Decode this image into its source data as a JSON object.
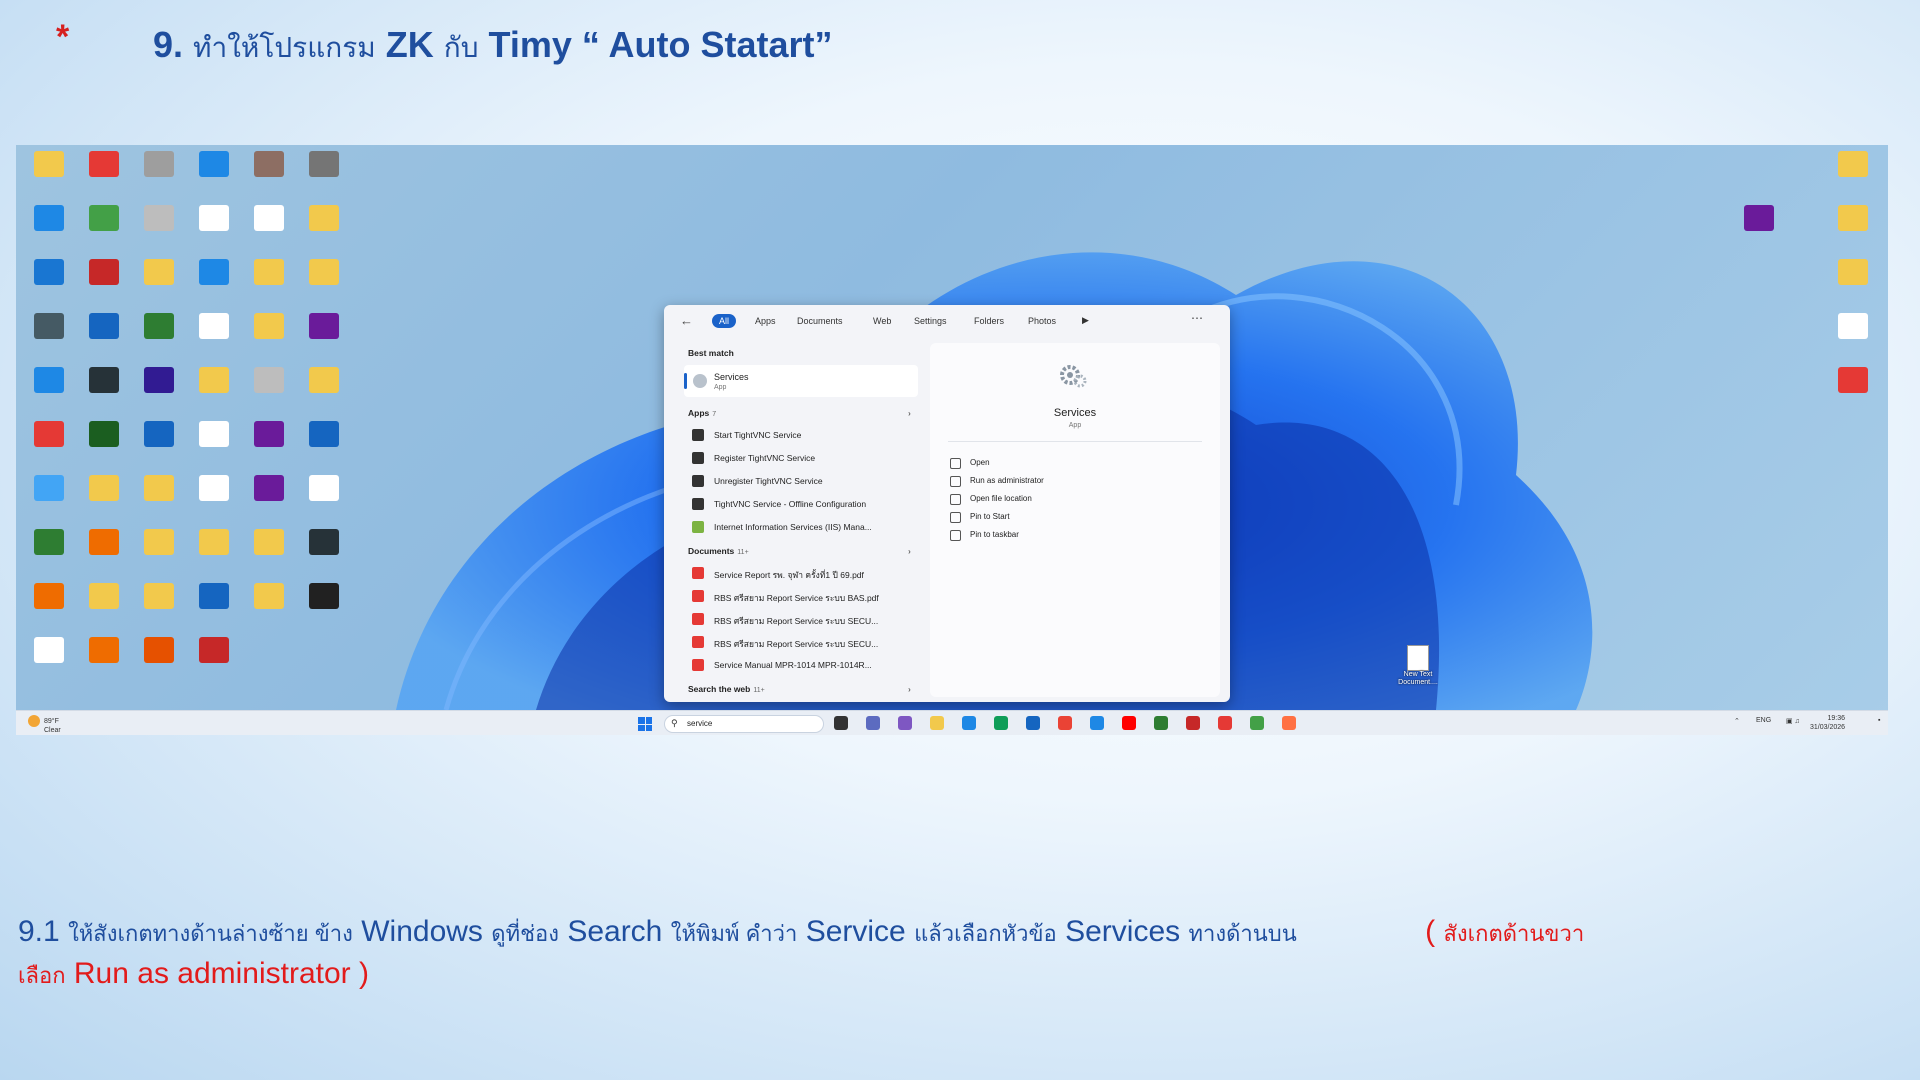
{
  "slide": {
    "asterisk": "*",
    "title_num": "9.",
    "title_th1": "ทำให้โปรแกรม",
    "title_zk": "ZK",
    "title_th2": "กับ",
    "title_timy": "Timy “ Auto Statart”"
  },
  "instruction": {
    "p1_num": "9.1",
    "p1_th1": "ให้สังเกตทางด้านล่างซ้าย ข้าง",
    "p1_windows": "Windows",
    "p1_th2": "ดูที่ช่อง",
    "p1_search": "Search",
    "p1_th3": "ให้พิมพ์ คำว่า",
    "p1_service": "Service",
    "p1_th4": "แล้วเลือกหัวข้อ",
    "p1_services": "Services",
    "p1_th5": "ทางด้านบน",
    "red_open": "(",
    "red_th1": "สังเกตด้านขวา",
    "red_th2": "เลือก",
    "red_run": "Run as administrator )"
  },
  "search_menu": {
    "back_icon": "arrow-left",
    "filters": [
      "All",
      "Apps",
      "Documents",
      "Web",
      "Settings",
      "Folders",
      "Photos"
    ],
    "active_filter": "All",
    "best_match_heading": "Best match",
    "best_match": {
      "name": "Services",
      "type": "App"
    },
    "apps_heading": "Apps",
    "apps_count": "7",
    "apps": [
      "Start TightVNC Service",
      "Register TightVNC Service",
      "Unregister TightVNC Service",
      "TightVNC Service - Offline Configuration",
      "Internet Information Services (IIS) Mana..."
    ],
    "documents_heading": "Documents",
    "documents_count": "11+",
    "documents": [
      "Service Report รพ. จุฬา ครั้งที่1 ปี 69.pdf",
      "RBS ศรีสยาม Report Service ระบบ BAS.pdf",
      "RBS ศรีสยาม Report Service ระบบ SECU...",
      "RBS ศรีสยาม Report Service ระบบ SECU...",
      "Service Manual MPR-1014 MPR-1014R..."
    ],
    "web_heading": "Search the web",
    "web_count": "11+",
    "preview": {
      "title": "Services",
      "subtitle": "App",
      "actions": [
        "Open",
        "Run as administrator",
        "Open file location",
        "Pin to Start",
        "Pin to taskbar"
      ]
    }
  },
  "taskbar": {
    "weather_temp": "89°F",
    "weather_cond": "Clear",
    "search_text": "service",
    "tray_lang": "ENG",
    "time": "19:36",
    "date": "31/03/2026"
  },
  "desktop": {
    "new_text_doc": "New Text Document....",
    "icon_colors": [
      "#f2c94c",
      "#e53935",
      "#9e9e9e",
      "#1e88e5",
      "#8d6e63",
      "#757575",
      "#1e88e5",
      "#43a047",
      "#bdbdbd",
      "#ffffff",
      "#ffffff",
      "#f2c94c",
      "#1976d2",
      "#c62828",
      "#f2c94c",
      "#1e88e5",
      "#f2c94c",
      "#f2c94c",
      "#455a64",
      "#1565c0",
      "#2e7d32",
      "#ffffff",
      "#f2c94c",
      "#6a1b9a",
      "#1e88e5",
      "#263238",
      "#311b92",
      "#f2c94c",
      "#bdbdbd",
      "#f2c94c",
      "#e53935",
      "#1b5e20",
      "#1565c0",
      "#ffffff",
      "#6a1b9a",
      "#1565c0",
      "#42a5f5",
      "#f2c94c",
      "#f2c94c",
      "#ffffff",
      "#6a1b9a",
      "#ffffff",
      "#2e7d32",
      "#ef6c00",
      "#f2c94c",
      "#f2c94c",
      "#f2c94c",
      "#263238",
      "#ef6c00",
      "#f2c94c",
      "#f2c94c",
      "#1565c0",
      "#f2c94c",
      "#212121",
      "#ffffff",
      "#ef6c00",
      "#e65100",
      "#c62828"
    ]
  }
}
